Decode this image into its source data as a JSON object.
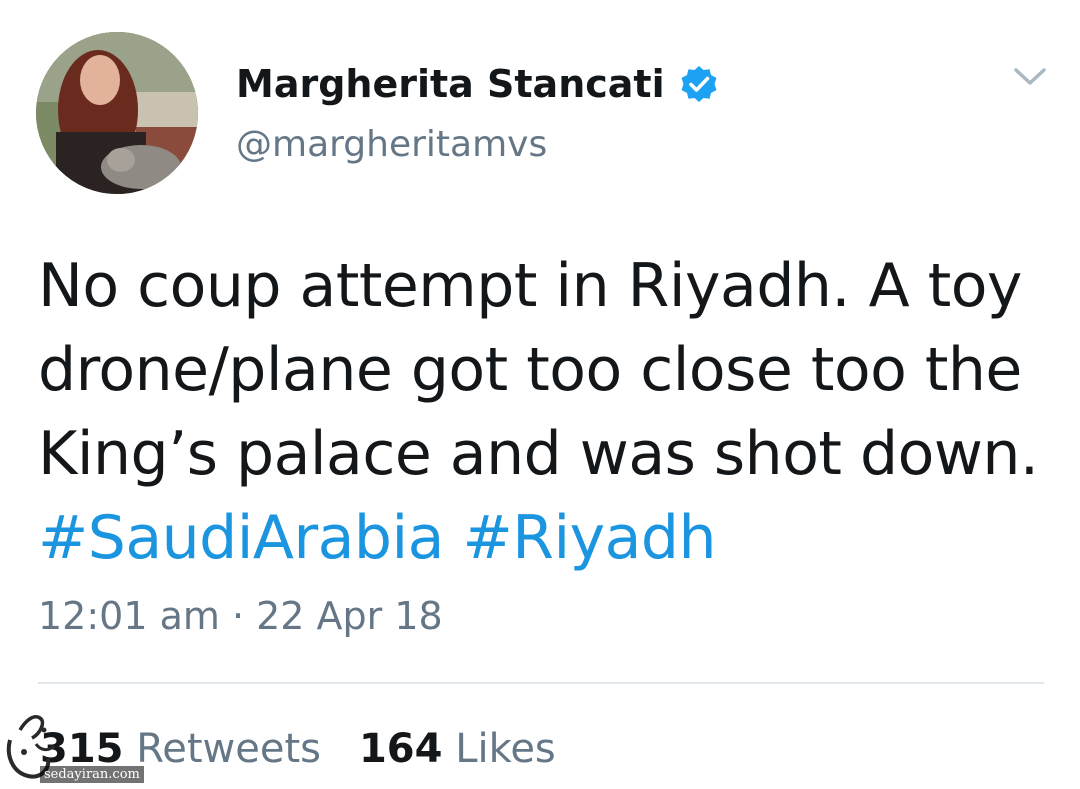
{
  "author": {
    "name": "Margherita Stancati",
    "handle": "@margheritamvs",
    "verified": true
  },
  "tweet": {
    "text_lines": [
      "No coup attempt in Riyadh. A toy",
      "drone/plane got too close too the",
      "King’s palace and was shot down."
    ],
    "hashtags": [
      "#SaudiArabia",
      "#Riyadh"
    ],
    "timestamp": "12:01 am · 22 Apr 18"
  },
  "stats": {
    "retweets_count": "315",
    "retweets_label": "Retweets",
    "likes_count": "164",
    "likes_label": "Likes"
  },
  "watermark": {
    "text": "sedayiran.com"
  },
  "colors": {
    "link": "#1b95e0",
    "verified": "#1da1f2",
    "secondary_text": "#657786",
    "primary_text": "#14171a"
  },
  "icons": {
    "more": "chevron-down-icon",
    "verified": "verified-badge-icon"
  }
}
